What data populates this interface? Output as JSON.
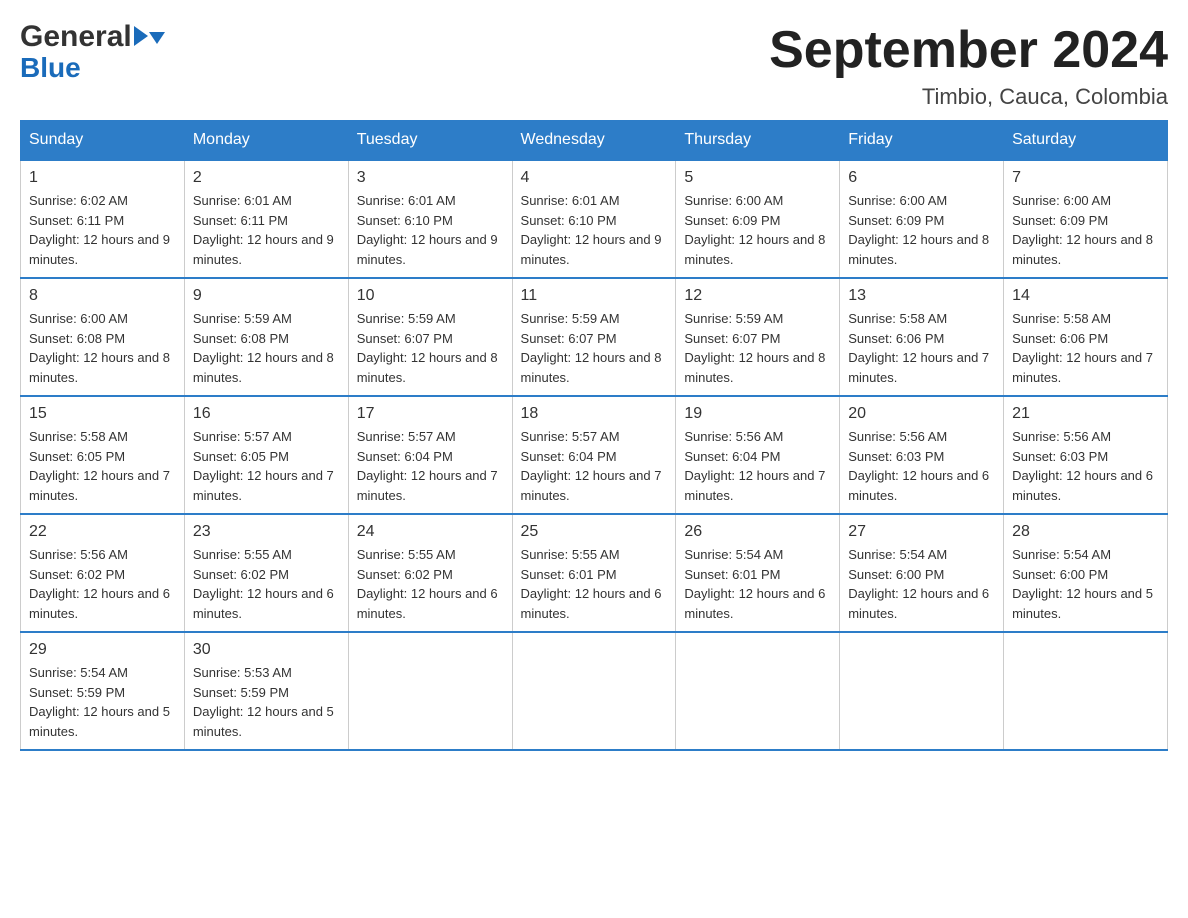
{
  "header": {
    "logo": {
      "general": "General",
      "blue": "Blue",
      "aria": "GeneralBlue Logo"
    },
    "title": "September 2024",
    "location": "Timbio, Cauca, Colombia"
  },
  "calendar": {
    "days_of_week": [
      "Sunday",
      "Monday",
      "Tuesday",
      "Wednesday",
      "Thursday",
      "Friday",
      "Saturday"
    ],
    "weeks": [
      [
        {
          "day": "1",
          "sunrise": "6:02 AM",
          "sunset": "6:11 PM",
          "daylight": "12 hours and 9 minutes."
        },
        {
          "day": "2",
          "sunrise": "6:01 AM",
          "sunset": "6:11 PM",
          "daylight": "12 hours and 9 minutes."
        },
        {
          "day": "3",
          "sunrise": "6:01 AM",
          "sunset": "6:10 PM",
          "daylight": "12 hours and 9 minutes."
        },
        {
          "day": "4",
          "sunrise": "6:01 AM",
          "sunset": "6:10 PM",
          "daylight": "12 hours and 9 minutes."
        },
        {
          "day": "5",
          "sunrise": "6:00 AM",
          "sunset": "6:09 PM",
          "daylight": "12 hours and 8 minutes."
        },
        {
          "day": "6",
          "sunrise": "6:00 AM",
          "sunset": "6:09 PM",
          "daylight": "12 hours and 8 minutes."
        },
        {
          "day": "7",
          "sunrise": "6:00 AM",
          "sunset": "6:09 PM",
          "daylight": "12 hours and 8 minutes."
        }
      ],
      [
        {
          "day": "8",
          "sunrise": "6:00 AM",
          "sunset": "6:08 PM",
          "daylight": "12 hours and 8 minutes."
        },
        {
          "day": "9",
          "sunrise": "5:59 AM",
          "sunset": "6:08 PM",
          "daylight": "12 hours and 8 minutes."
        },
        {
          "day": "10",
          "sunrise": "5:59 AM",
          "sunset": "6:07 PM",
          "daylight": "12 hours and 8 minutes."
        },
        {
          "day": "11",
          "sunrise": "5:59 AM",
          "sunset": "6:07 PM",
          "daylight": "12 hours and 8 minutes."
        },
        {
          "day": "12",
          "sunrise": "5:59 AM",
          "sunset": "6:07 PM",
          "daylight": "12 hours and 8 minutes."
        },
        {
          "day": "13",
          "sunrise": "5:58 AM",
          "sunset": "6:06 PM",
          "daylight": "12 hours and 7 minutes."
        },
        {
          "day": "14",
          "sunrise": "5:58 AM",
          "sunset": "6:06 PM",
          "daylight": "12 hours and 7 minutes."
        }
      ],
      [
        {
          "day": "15",
          "sunrise": "5:58 AM",
          "sunset": "6:05 PM",
          "daylight": "12 hours and 7 minutes."
        },
        {
          "day": "16",
          "sunrise": "5:57 AM",
          "sunset": "6:05 PM",
          "daylight": "12 hours and 7 minutes."
        },
        {
          "day": "17",
          "sunrise": "5:57 AM",
          "sunset": "6:04 PM",
          "daylight": "12 hours and 7 minutes."
        },
        {
          "day": "18",
          "sunrise": "5:57 AM",
          "sunset": "6:04 PM",
          "daylight": "12 hours and 7 minutes."
        },
        {
          "day": "19",
          "sunrise": "5:56 AM",
          "sunset": "6:04 PM",
          "daylight": "12 hours and 7 minutes."
        },
        {
          "day": "20",
          "sunrise": "5:56 AM",
          "sunset": "6:03 PM",
          "daylight": "12 hours and 6 minutes."
        },
        {
          "day": "21",
          "sunrise": "5:56 AM",
          "sunset": "6:03 PM",
          "daylight": "12 hours and 6 minutes."
        }
      ],
      [
        {
          "day": "22",
          "sunrise": "5:56 AM",
          "sunset": "6:02 PM",
          "daylight": "12 hours and 6 minutes."
        },
        {
          "day": "23",
          "sunrise": "5:55 AM",
          "sunset": "6:02 PM",
          "daylight": "12 hours and 6 minutes."
        },
        {
          "day": "24",
          "sunrise": "5:55 AM",
          "sunset": "6:02 PM",
          "daylight": "12 hours and 6 minutes."
        },
        {
          "day": "25",
          "sunrise": "5:55 AM",
          "sunset": "6:01 PM",
          "daylight": "12 hours and 6 minutes."
        },
        {
          "day": "26",
          "sunrise": "5:54 AM",
          "sunset": "6:01 PM",
          "daylight": "12 hours and 6 minutes."
        },
        {
          "day": "27",
          "sunrise": "5:54 AM",
          "sunset": "6:00 PM",
          "daylight": "12 hours and 6 minutes."
        },
        {
          "day": "28",
          "sunrise": "5:54 AM",
          "sunset": "6:00 PM",
          "daylight": "12 hours and 5 minutes."
        }
      ],
      [
        {
          "day": "29",
          "sunrise": "5:54 AM",
          "sunset": "5:59 PM",
          "daylight": "12 hours and 5 minutes."
        },
        {
          "day": "30",
          "sunrise": "5:53 AM",
          "sunset": "5:59 PM",
          "daylight": "12 hours and 5 minutes."
        },
        null,
        null,
        null,
        null,
        null
      ]
    ]
  }
}
